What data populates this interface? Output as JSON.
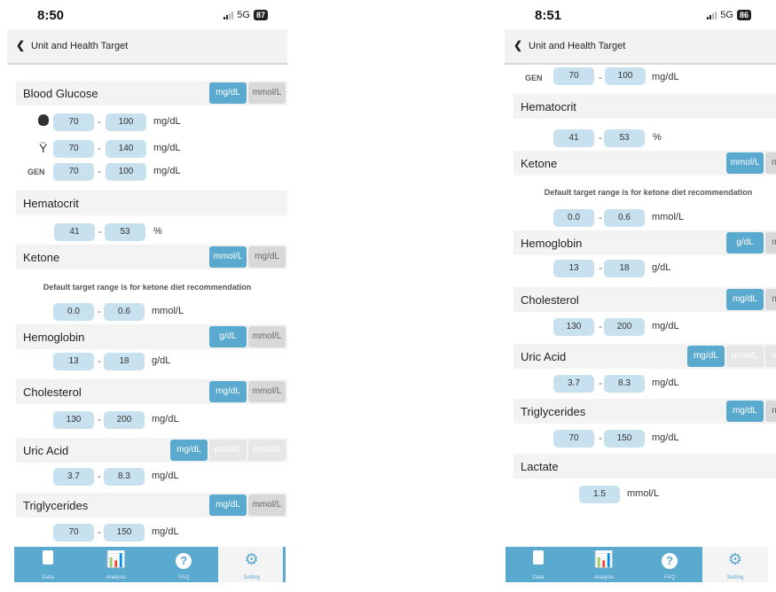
{
  "screens": [
    {
      "time": "8:50",
      "network": "5G",
      "battery": "87",
      "nav_title": "Unit and Health Target",
      "blood_glucose": {
        "label": "Blood Glucose",
        "units": [
          "mg/dL",
          "mmol/L"
        ],
        "rows": [
          {
            "icon": "apple-icon",
            "low": "70",
            "high": "100",
            "unit": "mg/dL"
          },
          {
            "icon": "fork-icon",
            "low": "70",
            "high": "140",
            "unit": "mg/dL"
          },
          {
            "icon": "GEN",
            "low": "70",
            "high": "100",
            "unit": "mg/dL"
          }
        ]
      },
      "hematocrit": {
        "label": "Hematocrit",
        "low": "41",
        "high": "53",
        "unit": "%"
      },
      "ketone": {
        "label": "Ketone",
        "units": [
          "mmol/L",
          "mg/dL"
        ],
        "note": "Default target range is for ketone diet recommendation",
        "low": "0.0",
        "high": "0.6",
        "unit": "mmol/L"
      },
      "hemoglobin": {
        "label": "Hemoglobin",
        "units": [
          "g/dL",
          "mmol/L"
        ],
        "low": "13",
        "high": "18",
        "unit": "g/dL"
      },
      "cholesterol": {
        "label": "Cholesterol",
        "units": [
          "mg/dL",
          "mmol/L"
        ],
        "low": "130",
        "high": "200",
        "unit": "mg/dL"
      },
      "uric_acid": {
        "label": "Uric Acid",
        "units": [
          "mg/dL",
          "µmol/L",
          "mmol/L"
        ],
        "low": "3.7",
        "high": "8.3",
        "unit": "mg/dL"
      },
      "triglycerides": {
        "label": "Triglycerides",
        "units": [
          "mg/dL",
          "mmol/L"
        ],
        "low": "70",
        "high": "150",
        "unit": "mg/dL"
      },
      "tabs": [
        "Data",
        "Analysis",
        "FAQ",
        "Setting"
      ]
    },
    {
      "time": "8:51",
      "network": "5G",
      "battery": "86",
      "nav_title": "Unit and Health Target",
      "gen_row": {
        "icon": "GEN",
        "low": "70",
        "high": "100",
        "unit": "mg/dL"
      },
      "hematocrit": {
        "label": "Hematocrit",
        "low": "41",
        "high": "53",
        "unit": "%"
      },
      "ketone": {
        "label": "Ketone",
        "units": [
          "mmol/L",
          "mg/dL"
        ],
        "note": "Default target range is for ketone diet recommendation",
        "low": "0.0",
        "high": "0.6",
        "unit": "mmol/L"
      },
      "hemoglobin": {
        "label": "Hemoglobin",
        "units": [
          "g/dL",
          "mmol/"
        ],
        "low": "13",
        "high": "18",
        "unit": "g/dL"
      },
      "cholesterol": {
        "label": "Cholesterol",
        "units": [
          "mg/dL",
          "mmol/"
        ],
        "low": "130",
        "high": "200",
        "unit": "mg/dL"
      },
      "uric_acid": {
        "label": "Uric Acid",
        "units": [
          "mg/dL",
          "µmol/L",
          "mmol/"
        ],
        "low": "3.7",
        "high": "8.3",
        "unit": "mg/dL"
      },
      "triglycerides": {
        "label": "Triglycerides",
        "units": [
          "mg/dL",
          "mmol/"
        ],
        "low": "70",
        "high": "150",
        "unit": "mg/dL"
      },
      "lactate": {
        "label": "Lactate",
        "value": "1.5",
        "unit": "mmol/L"
      },
      "tabs": [
        "Data",
        "Analysis",
        "FAQ",
        "Setting"
      ]
    }
  ],
  "colors": {
    "accent": "#5aa9cf",
    "pill": "#c8e1ee",
    "section_bg": "#f3f3f3"
  }
}
